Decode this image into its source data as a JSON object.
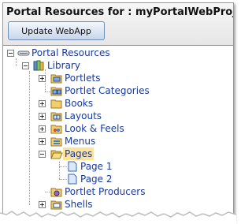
{
  "panel": {
    "title": "Portal Resources for : myPortalWebProject",
    "update_button": "Update WebApp"
  },
  "tree": {
    "root": "Portal Resources",
    "library": "Library",
    "items": {
      "portlets": "Portlets",
      "portlet_categories": "Portlet Categories",
      "books": "Books",
      "layouts": "Layouts",
      "look_feels": "Look & Feels",
      "menus": "Menus",
      "pages": "Pages",
      "page1": "Page 1",
      "page2": "Page 2",
      "portlet_producers": "Portlet Producers",
      "shells": "Shells"
    },
    "selected": "Pages"
  },
  "colors": {
    "link_text": "#1a3a9a",
    "selection": "#fde39a",
    "button_border": "#6f8db8"
  }
}
